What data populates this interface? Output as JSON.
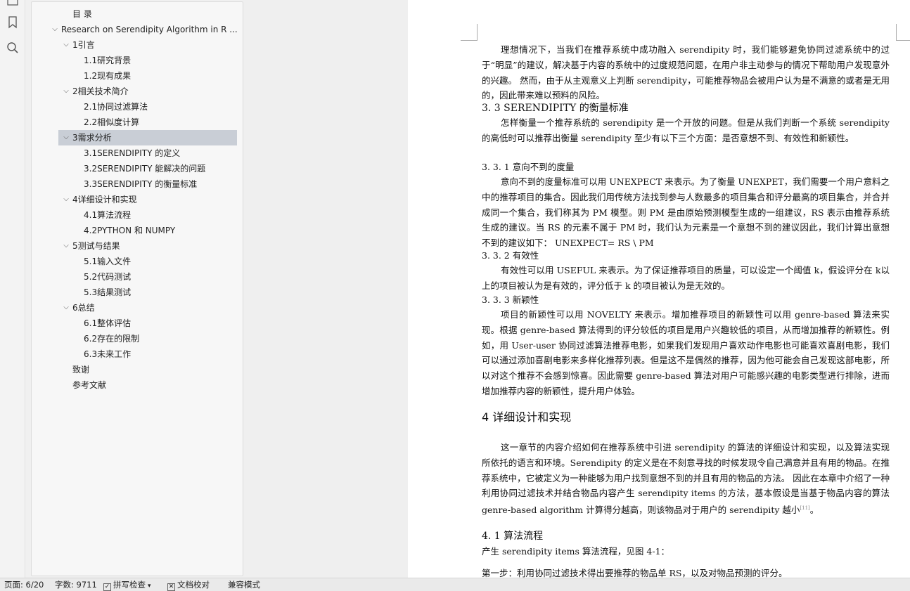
{
  "nav": {
    "items": [
      {
        "label": "目 录",
        "level": 1,
        "expand": ""
      },
      {
        "label": "Research on Serendipity Algorithm in R ...",
        "level": 0,
        "expand": "v"
      },
      {
        "label": "1引言",
        "level": 1,
        "expand": "v"
      },
      {
        "label": "1.1研究背景",
        "level": 2,
        "expand": ""
      },
      {
        "label": "1.2现有成果",
        "level": 2,
        "expand": ""
      },
      {
        "label": "2相关技术简介",
        "level": 1,
        "expand": "v"
      },
      {
        "label": "2.1协同过滤算法",
        "level": 2,
        "expand": ""
      },
      {
        "label": "2.2相似度计算",
        "level": 2,
        "expand": ""
      },
      {
        "label": "3需求分析",
        "level": 1,
        "expand": "v",
        "selected": true
      },
      {
        "label": "3.1SERENDIPITY 的定义",
        "level": 2,
        "expand": ""
      },
      {
        "label": "3.2SERENDIPITY 能解决的问题",
        "level": 2,
        "expand": ""
      },
      {
        "label": "3.3SERENDIPITY 的衡量标准",
        "level": 2,
        "expand": ""
      },
      {
        "label": "4详细设计和实现",
        "level": 1,
        "expand": "v"
      },
      {
        "label": "4.1算法流程",
        "level": 2,
        "expand": ""
      },
      {
        "label": "4.2PYTHON 和 NUMPY",
        "level": 2,
        "expand": ""
      },
      {
        "label": "5测试与结果",
        "level": 1,
        "expand": "v"
      },
      {
        "label": "5.1输入文件",
        "level": 2,
        "expand": ""
      },
      {
        "label": "5.2代码测试",
        "level": 2,
        "expand": ""
      },
      {
        "label": "5.3结果测试",
        "level": 2,
        "expand": ""
      },
      {
        "label": "6总结",
        "level": 1,
        "expand": "v"
      },
      {
        "label": "6.1整体评估",
        "level": 2,
        "expand": ""
      },
      {
        "label": "6.2存在的限制",
        "level": 2,
        "expand": ""
      },
      {
        "label": "6.3未来工作",
        "level": 2,
        "expand": ""
      },
      {
        "label": "致谢",
        "level": 1,
        "expand": ""
      },
      {
        "label": "参考文献",
        "level": 1,
        "expand": ""
      }
    ]
  },
  "doc": {
    "p1": "理想情况下，当我们在推荐系统中成功融入 serendipity 时，我们能够避免协同过滤系统中的过于“明显”的建议，解决基于内容的系统中的过度规范问题，在用户非主动参与的情况下帮助用户发现意外的兴趣。 然而，由于从主观意义上判断 serendipity，可能推荐物品会被用户认为是不满意的或者是无用的，因此带来难以预料的风险。",
    "h_3_3": "3. 3 SERENDIPITY 的衡量标准",
    "p2": "怎样衡量一个推荐系统的 serendipity 是一个开放的问题。但是从我们判断一个系统 serendipity 的高低时可以推荐出衡量 serendipity 至少有以下三个方面：是否意想不到、有效性和新颖性。",
    "h_3_3_1": "3. 3. 1 意向不到的度量",
    "p3": "意向不到的度量标准可以用 UNEXPECT 来表示。为了衡量 UNEXPET，我们需要一个用户意料之中的推荐项目的集合。因此我们用传统方法找到参与人数最多的项目集合和评分最高的项目集合，并合并成同一个集合，我们称其为 PM 模型。则 PM 是由原始预测模型生成的一组建议，RS 表示由推荐系统生成的建议。当 RS 的元素不属于 PM 时，我们认为元素是一个意想不到的建议因此，我们计算出意想不到的建议如下： UNEXPECT= RS \\ PM",
    "h_3_3_2": "3. 3. 2 有效性",
    "p4": "有效性可以用 USEFUL 来表示。为了保证推荐项目的质量，可以设定一个阈值 k，假设评分在 k以上的项目被认为是有效的，评分低于 k 的项目被认为是无效的。",
    "h_3_3_3": "3. 3. 3 新颖性",
    "p5": "项目的新颖性可以用 NOVELTY 来表示。增加推荐项目的新颖性可以用 genre-based 算法来实现。根据 genre-based 算法得到的评分较低的项目是用户兴趣较低的项目，从而增加推荐的新颖性。例如，用 User-user 协同过滤算法推荐电影，如果我们发现用户喜欢动作电影也可能喜欢喜剧电影，我们可以通过添加喜剧电影来多样化推荐列表。但是这不是偶然的推荐，因为他可能会自己发现这部电影，所以对这个推荐不会感到惊喜。因此需要 genre-based 算法对用户可能感兴趣的电影类型进行排除，进而增加推荐内容的新颖性，提升用户体验。",
    "h_4": "4 详细设计和实现",
    "p6": "这一章节的内容介绍如何在推荐系统中引进 serendipity 的算法的详细设计和实现，以及算法实现所依托的语言和环境。Serendipity 的定义是在不刻意寻找的时候发现令自己满意并且有用的物品。在推荐系统中，它被定义为一种能够为用户找到意想不到的并且有用的物品的方法。 因此在本章中介绍了一种利用协同过滤技术并结合物品内容产生 serendipity items 的方法，基本假设是当基于物品内容的算法 genre-based algorithm 计算得分越高，则该物品对于用户的 serendipity 越小",
    "p6_cite": "[11]",
    "p6_end": "。",
    "h_4_1": "4. 1 算法流程",
    "p7": "产生 serendipity items 算法流程，见图 4-1：",
    "p8": "第一步：利用协同过滤技术得出要推荐的物品单 RS，以及对物品预测的评分。"
  },
  "status": {
    "page": "页面: 6/20",
    "words": "字数: 9711",
    "spell": "拼写检查",
    "doc_check": "文档校对",
    "compat": "兼容模式"
  }
}
